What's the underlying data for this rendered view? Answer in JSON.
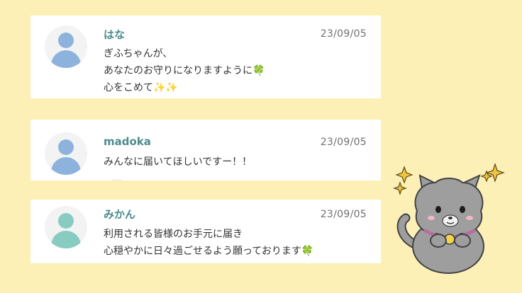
{
  "comments": [
    {
      "name": "はな",
      "date": "23/09/05",
      "avatar_color": "#8db3dd",
      "lines": [
        "ぎふちゃんが、",
        "あなたのお守りになりますように",
        "心をこめて"
      ],
      "emoji": {
        "clover": "🍀",
        "sparkles": "✨✨"
      }
    },
    {
      "name": "madoka",
      "date": "23/09/05",
      "avatar_color": "#8db3dd",
      "lines": [
        "みんなに届いてほしいですー！！"
      ]
    },
    {
      "name": "みかん",
      "date": "23/09/05",
      "avatar_color": "#88cbc1",
      "lines": [
        "利用される皆様のお手元に届き",
        "心穏やかに日々過ごせるよう願っております"
      ],
      "emoji": {
        "clover": "🍀"
      }
    }
  ],
  "colors": {
    "background": "#fdf0b7",
    "name_text": "#4c8b8c",
    "card": "#ffffff"
  },
  "mascot": {
    "icon": "gray-cat-mascot",
    "accents": [
      "sparkle-icon"
    ]
  }
}
